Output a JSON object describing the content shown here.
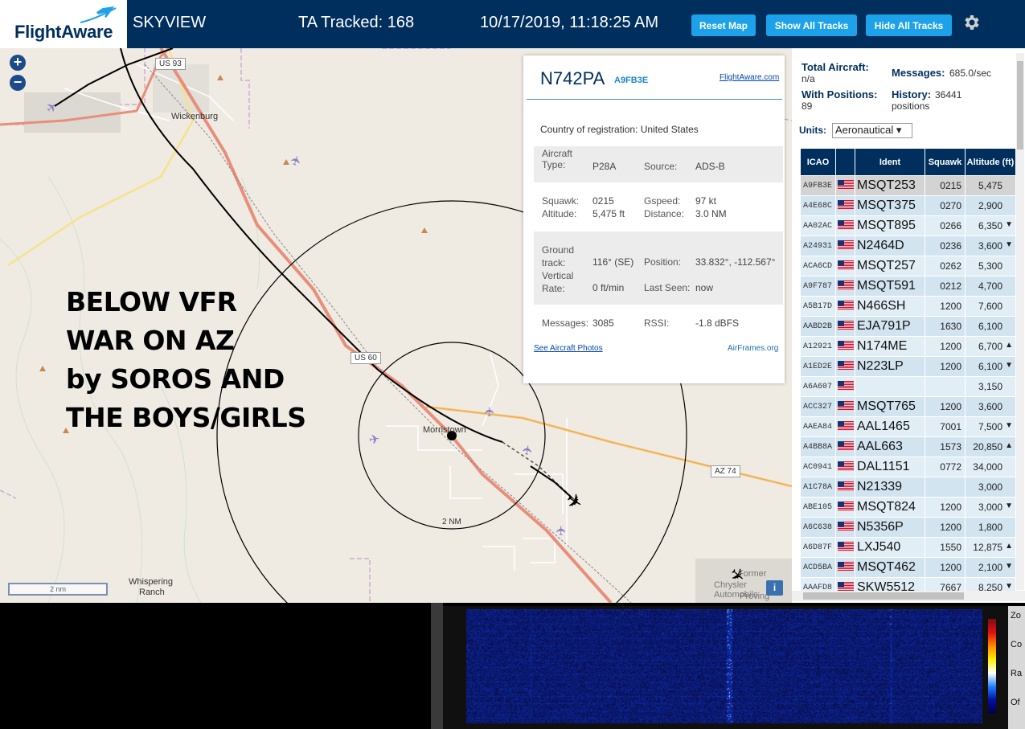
{
  "header": {
    "logo_text": "FlightAware",
    "app_name": "SKYVIEW",
    "tracked": "TA Tracked: 168",
    "datetime": "10/17/2019, 11:18:25 AM",
    "buttons": [
      "Reset Map",
      "Show All Tracks",
      "Hide All Tracks"
    ],
    "settings_icon": "gear-icon",
    "colors": {
      "bar": "#002f5d",
      "button": "#1da1e8"
    }
  },
  "map": {
    "zoom_in": "+",
    "zoom_out": "−",
    "overlay_text": [
      "BELOW VFR",
      "WAR ON AZ",
      "by SOROS AND",
      "THE BOYS/GIRLS"
    ],
    "places": [
      "Wickenburg",
      "Morristown",
      "Whispering",
      "Ranch",
      "Former",
      "Chrysler Automobile",
      "Proving"
    ],
    "roads": [
      "US 93",
      "US 60",
      "AZ 74"
    ],
    "range_label": "2 NM",
    "scale_label": "2 nm",
    "info_icon": "i"
  },
  "popup": {
    "ident": "N742PA",
    "icao": "A9FB3E",
    "link_flightaware": "FlightAware.com",
    "country_label": "Country of registration:",
    "country_value": "United States",
    "aircraft_type_label": [
      "Aircraft",
      "Type:"
    ],
    "aircraft_type": "P28A",
    "source_label": "Source:",
    "source": "ADS-B",
    "squawk_label": "Squawk:",
    "squawk": "0215",
    "altitude_label": "Altitude:",
    "altitude": "5,475 ft",
    "gspeed_label": "Gspeed:",
    "gspeed": "97 kt",
    "distance_label": "Distance:",
    "distance": "3.0 NM",
    "ground_track_label": [
      "Ground",
      "track:"
    ],
    "ground_track": "116° (SE)",
    "position_label": "Position:",
    "position": "33.832°, -112.567°",
    "vrate_label": [
      "Vertical",
      "Rate:"
    ],
    "vrate": "0 ft/min",
    "last_seen_label": "Last Seen:",
    "last_seen": "now",
    "messages_label": "Messages:",
    "messages": "3085",
    "rssi_label": "RSSI:",
    "rssi": "-1.8 dBFS",
    "link_photos": "See Aircraft Photos",
    "link_airframes": "AirFrames.org"
  },
  "side": {
    "total_aircraft_label": "Total Aircraft:",
    "total_aircraft": "n/a",
    "messages_label": "Messages:",
    "messages": "685.0/sec",
    "with_positions_label": "With Positions:",
    "with_positions": "89",
    "history_label": "History:",
    "history": "36441",
    "history_unit": "positions",
    "units_label": "Units:",
    "units_value": "Aeronautical ▾",
    "columns": [
      "ICAO",
      "",
      "Ident",
      "Squawk",
      "Altitude (ft)"
    ],
    "rows": [
      {
        "icao": "A9FB3E",
        "ident": "MSQT253",
        "squawk": "0215",
        "alt": "5,475",
        "trend": ""
      },
      {
        "icao": "A4E68C",
        "ident": "MSQT375",
        "squawk": "0270",
        "alt": "2,900",
        "trend": ""
      },
      {
        "icao": "AA02AC",
        "ident": "MSQT895",
        "squawk": "0266",
        "alt": "6,350",
        "trend": "▼"
      },
      {
        "icao": "A24931",
        "ident": "N2464D",
        "squawk": "0236",
        "alt": "3,600",
        "trend": "▼"
      },
      {
        "icao": "ACA6CD",
        "ident": "MSQT257",
        "squawk": "0262",
        "alt": "5,300",
        "trend": ""
      },
      {
        "icao": "A9F787",
        "ident": "MSQT591",
        "squawk": "0212",
        "alt": "4,700",
        "trend": ""
      },
      {
        "icao": "A5B17D",
        "ident": "N466SH",
        "squawk": "1200",
        "alt": "7,600",
        "trend": ""
      },
      {
        "icao": "AABD2B",
        "ident": "EJA791P",
        "squawk": "1630",
        "alt": "6,100",
        "trend": ""
      },
      {
        "icao": "A12921",
        "ident": "N174ME",
        "squawk": "1200",
        "alt": "6,700",
        "trend": "▲"
      },
      {
        "icao": "A1ED2E",
        "ident": "N223LP",
        "squawk": "1200",
        "alt": "6,100",
        "trend": "▼"
      },
      {
        "icao": "A6A607",
        "ident": "",
        "squawk": "",
        "alt": "3,150",
        "trend": ""
      },
      {
        "icao": "ACC327",
        "ident": "MSQT765",
        "squawk": "1200",
        "alt": "3,600",
        "trend": ""
      },
      {
        "icao": "AAEA84",
        "ident": "AAL1465",
        "squawk": "7001",
        "alt": "7,500",
        "trend": "▼"
      },
      {
        "icao": "A4BB8A",
        "ident": "AAL663",
        "squawk": "1573",
        "alt": "20,850",
        "trend": "▲"
      },
      {
        "icao": "AC0941",
        "ident": "DAL1151",
        "squawk": "0772",
        "alt": "34,000",
        "trend": ""
      },
      {
        "icao": "A1C78A",
        "ident": "N21339",
        "squawk": "",
        "alt": "3,000",
        "trend": ""
      },
      {
        "icao": "ABE105",
        "ident": "MSQT824",
        "squawk": "1200",
        "alt": "3,000",
        "trend": "▼"
      },
      {
        "icao": "A6C638",
        "ident": "N5356P",
        "squawk": "1200",
        "alt": "1,800",
        "trend": ""
      },
      {
        "icao": "A6D87F",
        "ident": "LXJ540",
        "squawk": "1550",
        "alt": "12,875",
        "trend": "▲"
      },
      {
        "icao": "ACD5BA",
        "ident": "MSQT462",
        "squawk": "1200",
        "alt": "2,100",
        "trend": "▼"
      },
      {
        "icao": "AAAFD8",
        "ident": "SKW5512",
        "squawk": "7667",
        "alt": "8,250",
        "trend": "▼"
      }
    ]
  },
  "spectrum": {
    "controls": [
      "Zo",
      "Co",
      "Ra",
      "Of"
    ]
  }
}
